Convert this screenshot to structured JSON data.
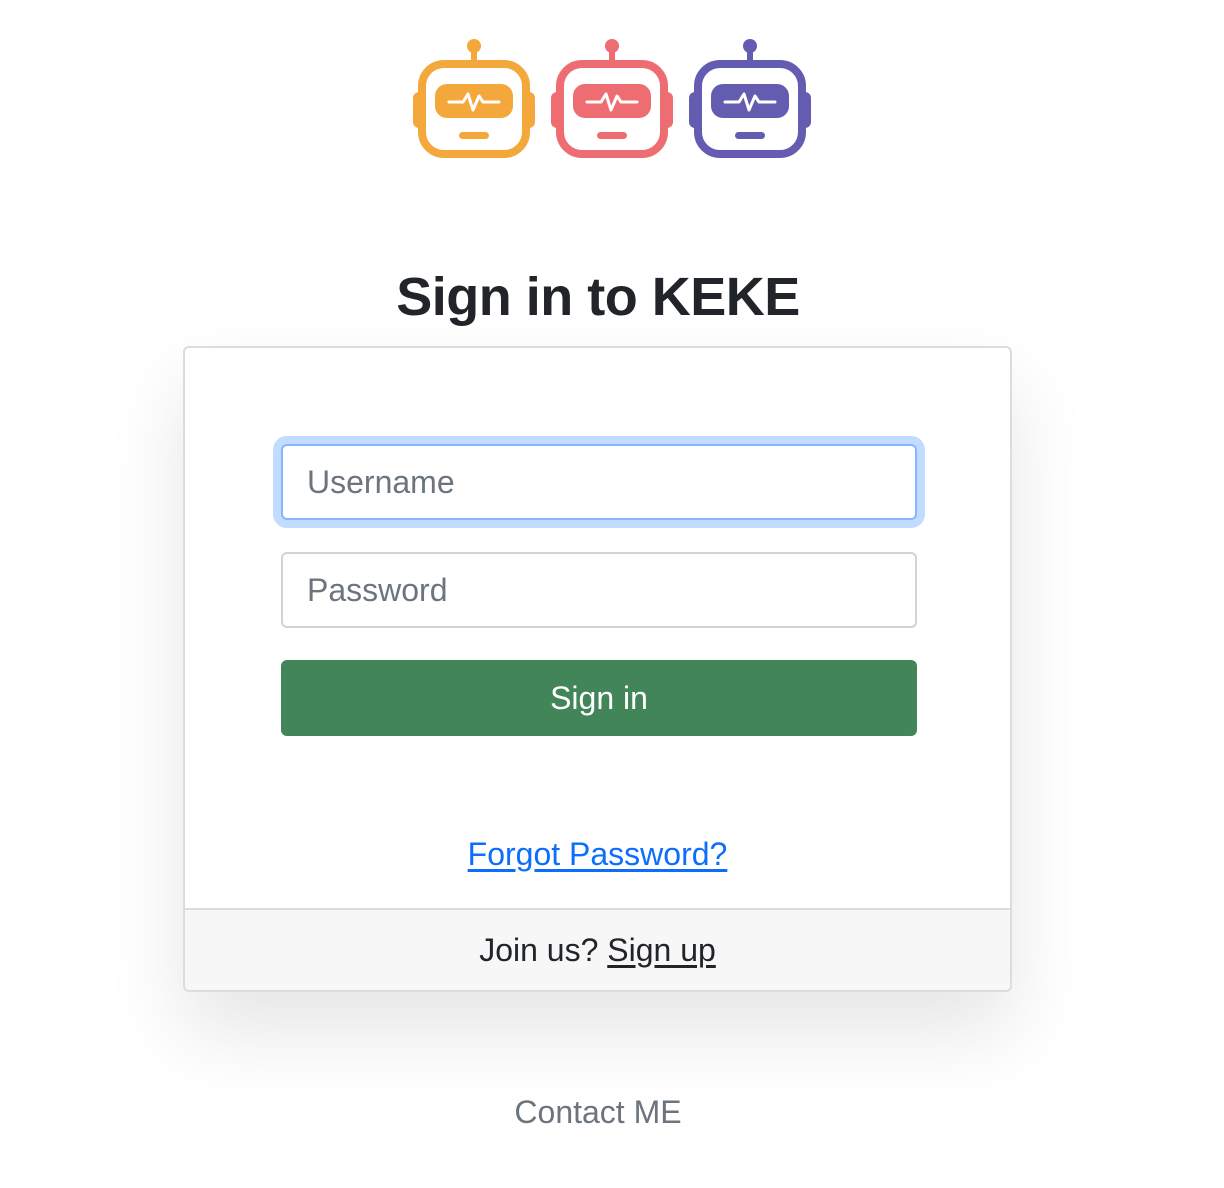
{
  "logo": {
    "robots": [
      {
        "icon": "robot-icon",
        "color": "#F4A83B"
      },
      {
        "icon": "robot-icon",
        "color": "#EE6D72"
      },
      {
        "icon": "robot-icon",
        "color": "#635CB1"
      }
    ]
  },
  "page": {
    "title": "Sign in to KEKE"
  },
  "form": {
    "username_placeholder": "Username",
    "username_value": "",
    "password_placeholder": "Password",
    "password_value": "",
    "submit_label": "Sign in",
    "submit_color": "#418559",
    "forgot_label": "Forgot Password?"
  },
  "footer": {
    "prompt": "Join us?",
    "signup_label": "Sign up"
  },
  "contact": {
    "label": "Contact ME"
  }
}
